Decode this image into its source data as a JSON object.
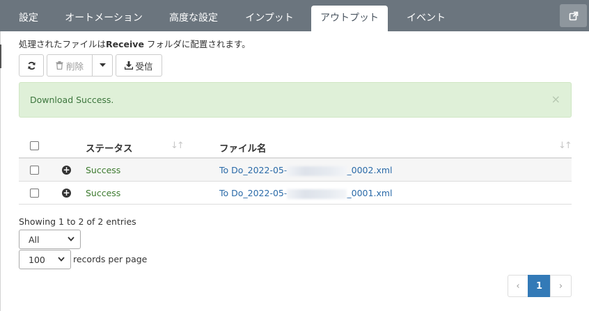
{
  "tabs": [
    {
      "label": "設定",
      "active": false
    },
    {
      "label": "オートメーション",
      "active": false
    },
    {
      "label": "高度な設定",
      "active": false
    },
    {
      "label": "インプット",
      "active": false
    },
    {
      "label": "アウトプット",
      "active": true
    },
    {
      "label": "イベント",
      "active": false
    }
  ],
  "info": {
    "prefix": "処理されたファイルは",
    "folder": "Receive",
    "suffix": " フォルダに配置されます。"
  },
  "toolbar": {
    "refresh_icon": "refresh-icon",
    "delete_label": "削除",
    "delete_icon": "trash-icon",
    "receive_label": "受信",
    "receive_icon": "download-icon"
  },
  "alert": {
    "message": "Download Success.",
    "close": "×",
    "color": "#dff0d8"
  },
  "table": {
    "columns": [
      "ステータス",
      "ファイル名"
    ],
    "rows": [
      {
        "status": "Success",
        "file_prefix": "To Do_2022-05-",
        "file_suffix": "_0002.xml"
      },
      {
        "status": "Success",
        "file_prefix": "To Do_2022-05-",
        "file_suffix": "_0001.xml"
      }
    ]
  },
  "footer": {
    "showing": "Showing 1 to 2 of 2 entries",
    "filter_value": "All",
    "per_page_value": "100",
    "per_page_label": "records per page"
  },
  "pagination": {
    "prev": "‹",
    "current": "1",
    "next": "›",
    "accent": "#337ab7"
  }
}
